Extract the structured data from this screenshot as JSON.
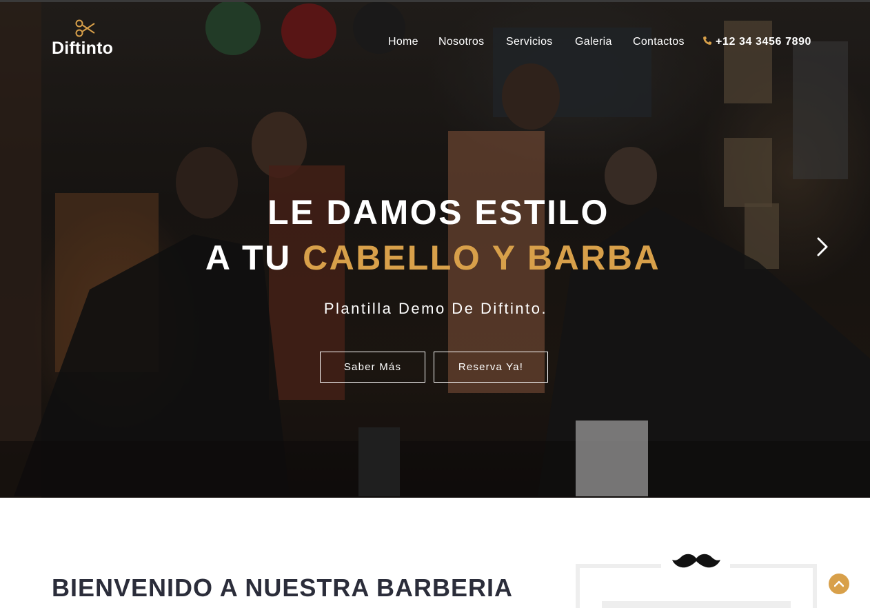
{
  "brand": {
    "name": "Diftinto",
    "icon": "scissors-icon"
  },
  "nav": {
    "items": [
      {
        "label": "Home"
      },
      {
        "label": "Nosotros"
      },
      {
        "label": "Servicios"
      },
      {
        "label": "Galeria"
      },
      {
        "label": "Contactos"
      }
    ],
    "phone": "+12 34 3456 7890",
    "phone_icon": "phone-icon"
  },
  "hero": {
    "line1": "LE DAMOS ESTILO",
    "line2_prefix": "A TU ",
    "line2_accent": "CABELLO Y BARBA",
    "subtitle": "Plantilla Demo De Diftinto.",
    "button_more": "Saber Más",
    "button_book": "Reserva Ya!",
    "next_icon": "chevron-right-icon"
  },
  "welcome": {
    "title": "BIENVENIDO A NUESTRA BARBERIA",
    "decor_icon": "mustache-icon"
  },
  "back_to_top_icon": "chevron-up-icon",
  "colors": {
    "accent": "#d8a04a",
    "heading": "#2b2d3a",
    "text_on_hero": "#ffffff"
  }
}
